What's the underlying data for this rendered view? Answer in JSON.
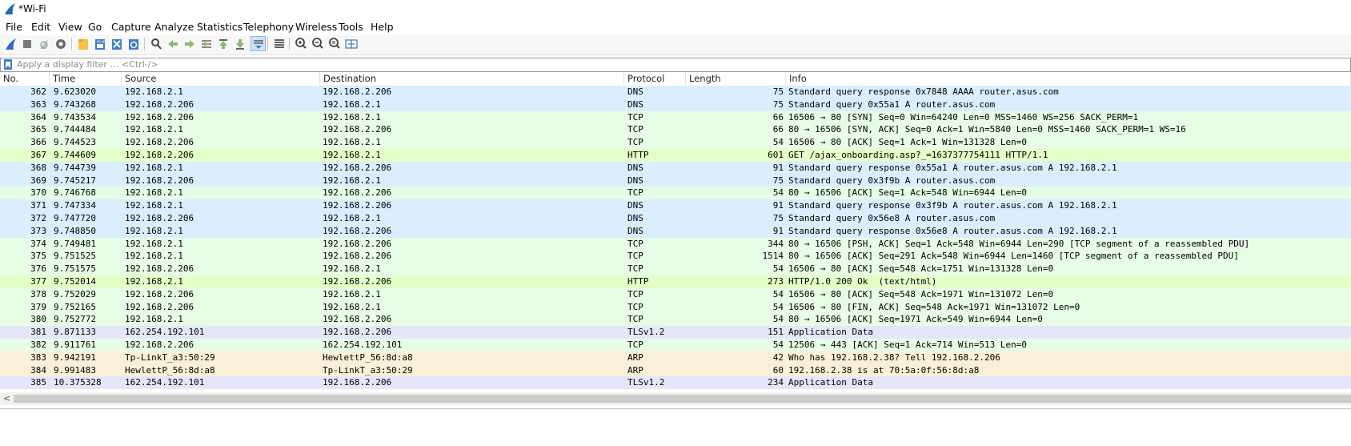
{
  "window": {
    "title": "*Wi-Fi",
    "app_icon": "wireshark-shark-fin-icon"
  },
  "menu": [
    "File",
    "Edit",
    "View",
    "Go",
    "Capture",
    "Analyze",
    "Statistics",
    "Telephony",
    "Wireless",
    "Tools",
    "Help"
  ],
  "toolbar": {
    "icons": [
      "start-capture-icon",
      "stop-capture-icon",
      "restart-capture-icon",
      "capture-options-icon",
      "open-file-icon",
      "save-file-icon",
      "close-file-icon",
      "reload-file-icon",
      "find-packet-icon",
      "go-back-icon",
      "go-forward-icon",
      "go-to-packet-icon",
      "go-first-packet-icon",
      "go-last-packet-icon",
      "autoscroll-icon",
      "colorize-icon",
      "zoom-in-icon",
      "zoom-out-icon",
      "normal-size-icon",
      "resize-columns-icon"
    ]
  },
  "filter": {
    "placeholder": "Apply a display filter … <Ctrl-/>",
    "value": ""
  },
  "columns": [
    "No.",
    "Time",
    "Source",
    "Destination",
    "Protocol",
    "Length",
    "Info"
  ],
  "row_colors": {
    "DNS": "#daeeff",
    "TCP": "#e7fde6",
    "HTTP": "#e4ffc7",
    "TLSv1.2": "#e6e6fa",
    "ARP": "#faf0d7"
  },
  "packets": [
    {
      "no": "362",
      "time": "9.623020",
      "src": "192.168.2.1",
      "dst": "192.168.2.206",
      "proto": "DNS",
      "len": "75",
      "info": "Standard query response 0x7848 AAAA router.asus.com"
    },
    {
      "no": "363",
      "time": "9.743268",
      "src": "192.168.2.206",
      "dst": "192.168.2.1",
      "proto": "DNS",
      "len": "75",
      "info": "Standard query 0x55a1 A router.asus.com"
    },
    {
      "no": "364",
      "time": "9.743534",
      "src": "192.168.2.206",
      "dst": "192.168.2.1",
      "proto": "TCP",
      "len": "66",
      "info": "16506 → 80 [SYN] Seq=0 Win=64240 Len=0 MSS=1460 WS=256 SACK_PERM=1"
    },
    {
      "no": "365",
      "time": "9.744484",
      "src": "192.168.2.1",
      "dst": "192.168.2.206",
      "proto": "TCP",
      "len": "66",
      "info": "80 → 16506 [SYN, ACK] Seq=0 Ack=1 Win=5840 Len=0 MSS=1460 SACK_PERM=1 WS=16"
    },
    {
      "no": "366",
      "time": "9.744523",
      "src": "192.168.2.206",
      "dst": "192.168.2.1",
      "proto": "TCP",
      "len": "54",
      "info": "16506 → 80 [ACK] Seq=1 Ack=1 Win=131328 Len=0"
    },
    {
      "no": "367",
      "time": "9.744609",
      "src": "192.168.2.206",
      "dst": "192.168.2.1",
      "proto": "HTTP",
      "len": "601",
      "info": "GET /ajax_onboarding.asp?_=1637377754111 HTTP/1.1"
    },
    {
      "no": "368",
      "time": "9.744739",
      "src": "192.168.2.1",
      "dst": "192.168.2.206",
      "proto": "DNS",
      "len": "91",
      "info": "Standard query response 0x55a1 A router.asus.com A 192.168.2.1"
    },
    {
      "no": "369",
      "time": "9.745217",
      "src": "192.168.2.206",
      "dst": "192.168.2.1",
      "proto": "DNS",
      "len": "75",
      "info": "Standard query 0x3f9b A router.asus.com"
    },
    {
      "no": "370",
      "time": "9.746768",
      "src": "192.168.2.1",
      "dst": "192.168.2.206",
      "proto": "TCP",
      "len": "54",
      "info": "80 → 16506 [ACK] Seq=1 Ack=548 Win=6944 Len=0"
    },
    {
      "no": "371",
      "time": "9.747334",
      "src": "192.168.2.1",
      "dst": "192.168.2.206",
      "proto": "DNS",
      "len": "91",
      "info": "Standard query response 0x3f9b A router.asus.com A 192.168.2.1"
    },
    {
      "no": "372",
      "time": "9.747720",
      "src": "192.168.2.206",
      "dst": "192.168.2.1",
      "proto": "DNS",
      "len": "75",
      "info": "Standard query 0x56e8 A router.asus.com"
    },
    {
      "no": "373",
      "time": "9.748850",
      "src": "192.168.2.1",
      "dst": "192.168.2.206",
      "proto": "DNS",
      "len": "91",
      "info": "Standard query response 0x56e8 A router.asus.com A 192.168.2.1"
    },
    {
      "no": "374",
      "time": "9.749481",
      "src": "192.168.2.1",
      "dst": "192.168.2.206",
      "proto": "TCP",
      "len": "344",
      "info": "80 → 16506 [PSH, ACK] Seq=1 Ack=548 Win=6944 Len=290 [TCP segment of a reassembled PDU]"
    },
    {
      "no": "375",
      "time": "9.751525",
      "src": "192.168.2.1",
      "dst": "192.168.2.206",
      "proto": "TCP",
      "len": "1514",
      "info": "80 → 16506 [ACK] Seq=291 Ack=548 Win=6944 Len=1460 [TCP segment of a reassembled PDU]"
    },
    {
      "no": "376",
      "time": "9.751575",
      "src": "192.168.2.206",
      "dst": "192.168.2.1",
      "proto": "TCP",
      "len": "54",
      "info": "16506 → 80 [ACK] Seq=548 Ack=1751 Win=131328 Len=0"
    },
    {
      "no": "377",
      "time": "9.752014",
      "src": "192.168.2.1",
      "dst": "192.168.2.206",
      "proto": "HTTP",
      "len": "273",
      "info": "HTTP/1.0 200 Ok  (text/html)"
    },
    {
      "no": "378",
      "time": "9.752029",
      "src": "192.168.2.206",
      "dst": "192.168.2.1",
      "proto": "TCP",
      "len": "54",
      "info": "16506 → 80 [ACK] Seq=548 Ack=1971 Win=131072 Len=0"
    },
    {
      "no": "379",
      "time": "9.752165",
      "src": "192.168.2.206",
      "dst": "192.168.2.1",
      "proto": "TCP",
      "len": "54",
      "info": "16506 → 80 [FIN, ACK] Seq=548 Ack=1971 Win=131072 Len=0"
    },
    {
      "no": "380",
      "time": "9.752772",
      "src": "192.168.2.1",
      "dst": "192.168.2.206",
      "proto": "TCP",
      "len": "54",
      "info": "80 → 16506 [ACK] Seq=1971 Ack=549 Win=6944 Len=0"
    },
    {
      "no": "381",
      "time": "9.871133",
      "src": "162.254.192.101",
      "dst": "192.168.2.206",
      "proto": "TLSv1.2",
      "len": "151",
      "info": "Application Data"
    },
    {
      "no": "382",
      "time": "9.911761",
      "src": "192.168.2.206",
      "dst": "162.254.192.101",
      "proto": "TCP",
      "len": "54",
      "info": "12506 → 443 [ACK] Seq=1 Ack=714 Win=513 Len=0"
    },
    {
      "no": "383",
      "time": "9.942191",
      "src": "Tp-LinkT_a3:50:29",
      "dst": "HewlettP_56:8d:a8",
      "proto": "ARP",
      "len": "42",
      "info": "Who has 192.168.2.38? Tell 192.168.2.206"
    },
    {
      "no": "384",
      "time": "9.991483",
      "src": "HewlettP_56:8d:a8",
      "dst": "Tp-LinkT_a3:50:29",
      "proto": "ARP",
      "len": "60",
      "info": "192.168.2.38 is at 70:5a:0f:56:8d:a8"
    },
    {
      "no": "385",
      "time": "10.375328",
      "src": "162.254.192.101",
      "dst": "192.168.2.206",
      "proto": "TLSv1.2",
      "len": "234",
      "info": "Application Data"
    }
  ]
}
